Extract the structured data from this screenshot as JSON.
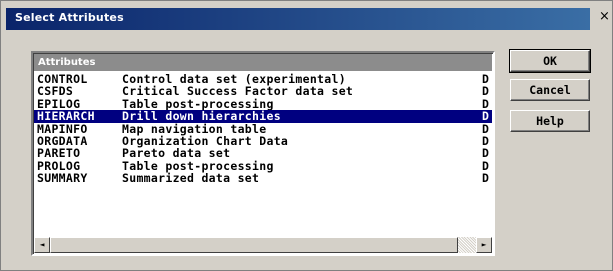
{
  "dialog": {
    "title": "Select Attributes",
    "close_glyph": "×",
    "close_icon": "close-icon"
  },
  "list": {
    "header": "Attributes",
    "selected_index": 3,
    "items": [
      {
        "name": "CONTROL",
        "description": "Control data set (experimental)",
        "flag": "D"
      },
      {
        "name": "CSFDS",
        "description": "Critical Success Factor data set",
        "flag": "D"
      },
      {
        "name": "EPILOG",
        "description": "Table post-processing",
        "flag": "D"
      },
      {
        "name": "HIERARCH",
        "description": "Drill down hierarchies",
        "flag": "D"
      },
      {
        "name": "MAPINFO",
        "description": "Map navigation table",
        "flag": "D"
      },
      {
        "name": "ORGDATA",
        "description": "Organization Chart Data",
        "flag": "D"
      },
      {
        "name": "PARETO",
        "description": "Pareto data set",
        "flag": "D"
      },
      {
        "name": "PROLOG",
        "description": "Table post-processing",
        "flag": "D"
      },
      {
        "name": "SUMMARY",
        "description": "Summarized data set",
        "flag": "D"
      }
    ]
  },
  "scrollbar": {
    "left_arrow": "◄",
    "right_arrow": "►",
    "left_icon": "arrow-left-icon",
    "right_icon": "arrow-right-icon"
  },
  "buttons": {
    "ok": "OK",
    "cancel": "Cancel",
    "help": "Help"
  },
  "colors": {
    "selection": "#000080",
    "title_bar": "#0a246a",
    "face": "#d4d0c8"
  }
}
